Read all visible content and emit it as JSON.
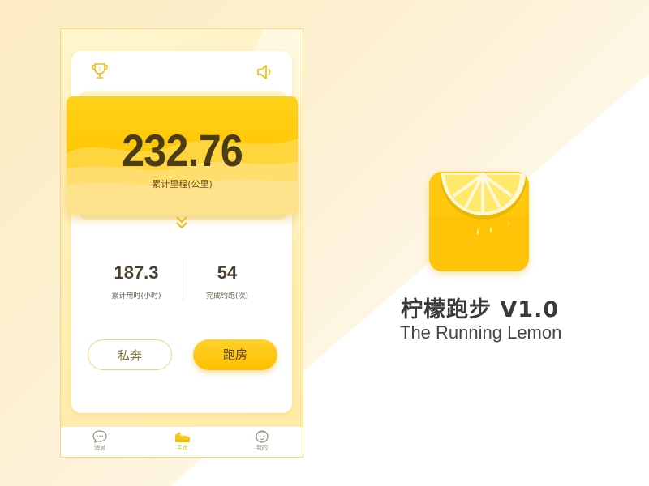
{
  "home": {
    "total_distance": "232.76",
    "total_distance_label": "累计里程(公里)",
    "stats": [
      {
        "value": "187.3",
        "label": "累计用时(小时)"
      },
      {
        "value": "54",
        "label": "完成约跑(次)"
      }
    ],
    "private_run_label": "私奔",
    "run_room_label": "跑房"
  },
  "tabbar": {
    "tabs": [
      {
        "label": "消息",
        "icon": "chat-icon"
      },
      {
        "label": "主页",
        "icon": "shoe-icon",
        "active": true
      },
      {
        "label": "我的",
        "icon": "face-icon"
      }
    ]
  },
  "brand": {
    "title": "柠檬跑步 V1.0",
    "subtitle": "The Running Lemon",
    "accent_color": "#FFC400",
    "text_color": "#3A3A3A"
  }
}
